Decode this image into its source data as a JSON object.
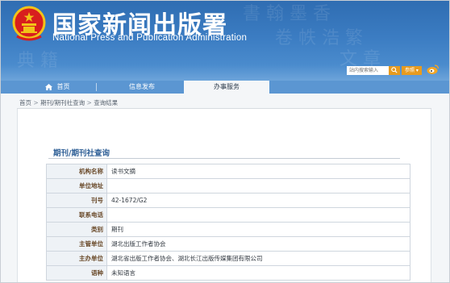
{
  "site": {
    "title_cn": "国家新闻出版署",
    "title_en": "National Press and Publication Administration"
  },
  "search": {
    "placeholder": "站内搜索输入",
    "scope_label": "参照"
  },
  "nav": {
    "items": [
      {
        "label": "首页"
      },
      {
        "label": "信息发布"
      },
      {
        "label": "办事服务"
      }
    ]
  },
  "breadcrumb": {
    "items": [
      "首页",
      "期刊/期刊社查询",
      "查询结果"
    ],
    "separator": ">"
  },
  "panel": {
    "title": "期刊/期刊社查询"
  },
  "table": {
    "rows": [
      {
        "label": "机构名称",
        "value": "读书文摘"
      },
      {
        "label": "单位地址",
        "value": ""
      },
      {
        "label": "刊号",
        "value": "42-1672/G2"
      },
      {
        "label": "联系电话",
        "value": ""
      },
      {
        "label": "类别",
        "value": "期刊"
      },
      {
        "label": "主管单位",
        "value": "湖北出版工作者协会"
      },
      {
        "label": "主办单位",
        "value": "湖北省出版工作者协会、湖北长江出版传媒集团有限公司"
      },
      {
        "label": "语种",
        "value": "未知语言"
      }
    ]
  },
  "colors": {
    "banner": "#3b7cc2",
    "nav": "#5b96d2",
    "accent_orange": "#e79b1f",
    "panel_title": "#2e5f96"
  },
  "icons": [
    "national-emblem-icon",
    "home-icon",
    "search-icon",
    "weibo-icon"
  ]
}
